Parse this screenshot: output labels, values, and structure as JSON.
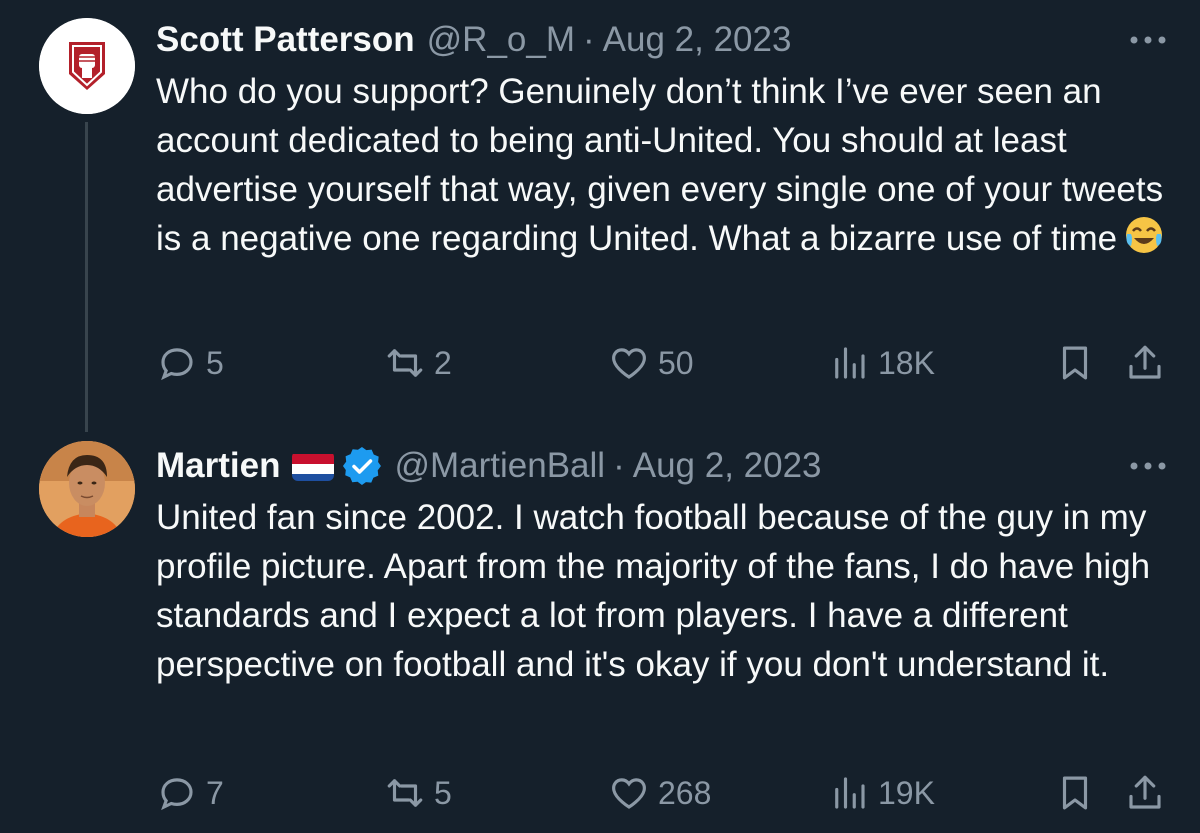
{
  "tweets": [
    {
      "author_name": "Scott Patterson",
      "handle": "@R_o_M",
      "separator": "·",
      "date": "Aug 2, 2023",
      "text": "Who do you support? Genuinely don’t think I’ve ever seen an account dedicated to being anti-United. You should at least advertise yourself that way, given every single one of your tweets is a negative one regarding United. What a bizarre use of time",
      "emoji": "face-with-tears-of-joy",
      "avatar_icon": "raised-fist-shield-icon",
      "counts": {
        "replies": "5",
        "retweets": "2",
        "likes": "50",
        "views": "18K"
      }
    },
    {
      "author_name": "Martien",
      "name_badges": [
        "netherlands-flag-icon",
        "verified-badge-icon"
      ],
      "handle": "@MartienBall",
      "separator": "·",
      "date": "Aug 2, 2023",
      "text": "United fan since 2002. I watch football because of the guy in my profile picture. Apart from the majority of the fans, I do have high standards and I expect a lot from players. I have a different perspective on football and it's okay if you don't understand it.",
      "avatar_icon": "profile-photo",
      "counts": {
        "replies": "7",
        "retweets": "5",
        "likes": "268",
        "views": "19K"
      }
    }
  ],
  "colors": {
    "background": "#15202b",
    "primary_text": "#f7f9f9",
    "secondary_text": "#8b98a5",
    "thread_line": "#38444d",
    "verified_blue": "#1d9bf0",
    "avatar_red": "#b3202a"
  },
  "icons": [
    "reply-icon",
    "retweet-icon",
    "like-icon",
    "views-icon",
    "bookmark-icon",
    "share-icon",
    "more-icon"
  ]
}
